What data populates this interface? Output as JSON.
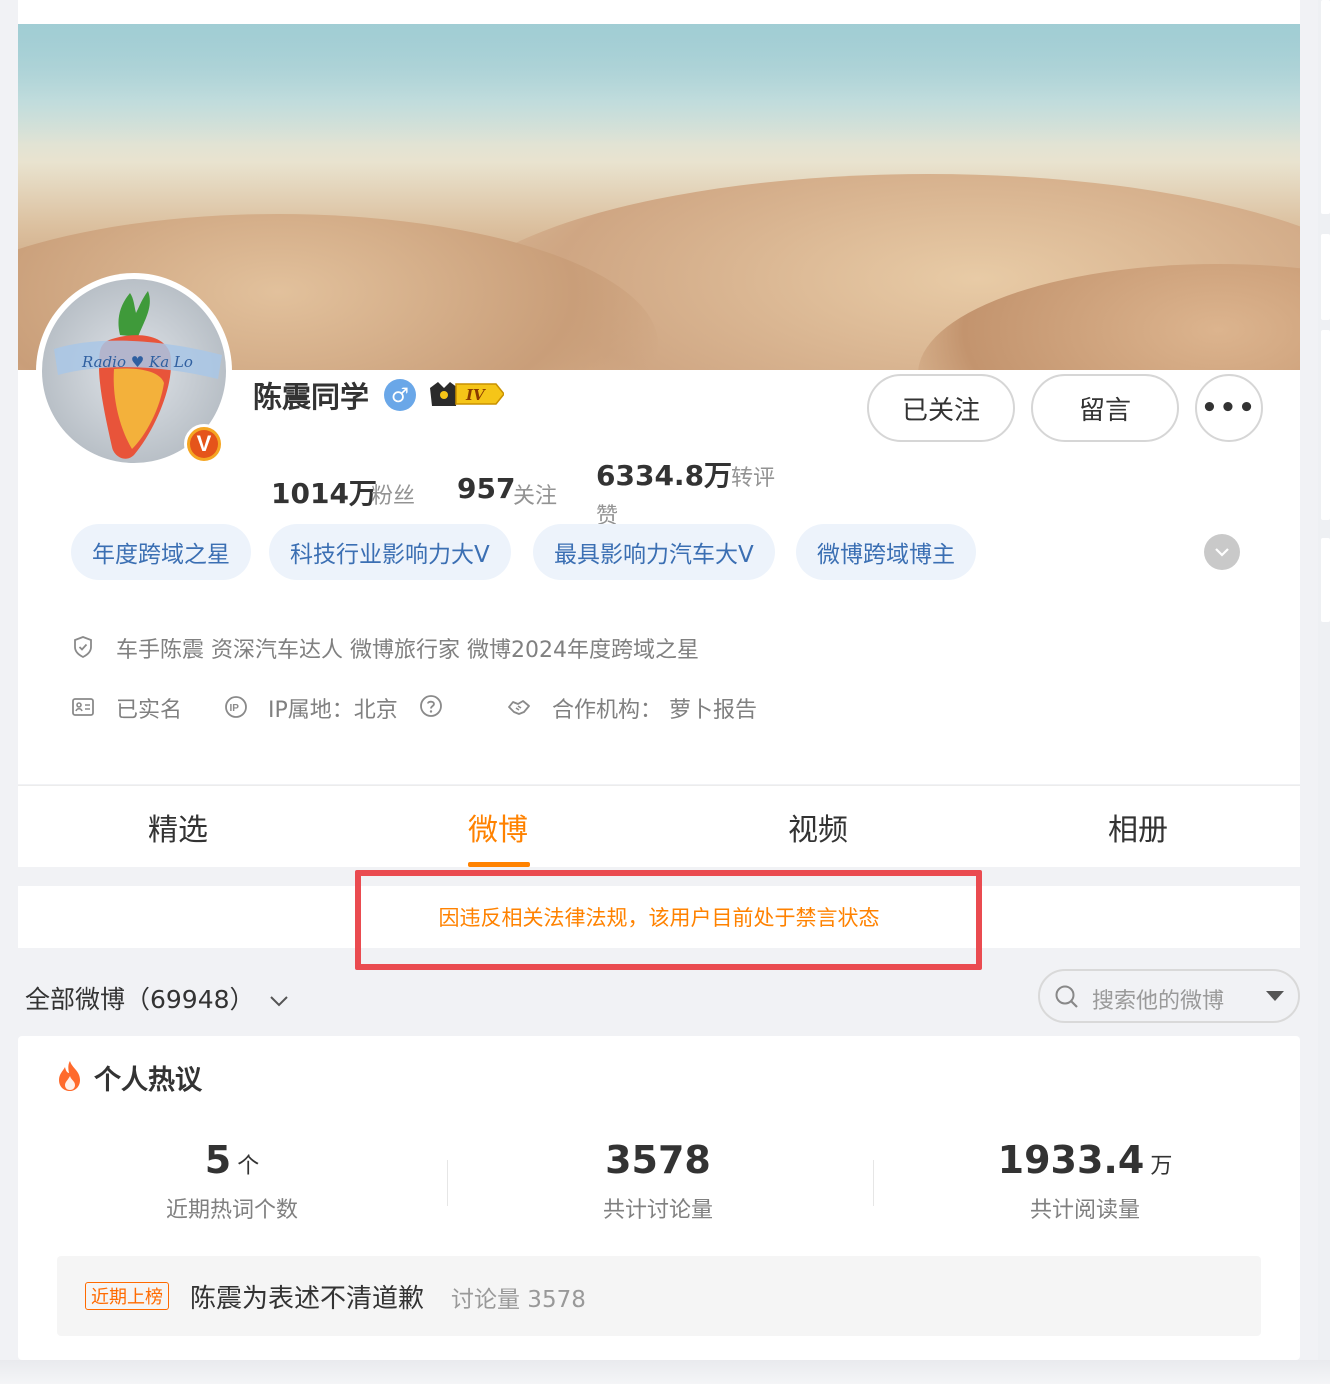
{
  "profile": {
    "name": "陈震同学",
    "gender_symbol": "♂",
    "level": "IV",
    "verified_mark": "V",
    "stats": [
      {
        "value": "1014万",
        "label": "粉丝"
      },
      {
        "value": "957",
        "label": "关注"
      },
      {
        "value": "6334.8万",
        "label": "转评",
        "label2": "赞"
      }
    ],
    "buttons": {
      "followed": "已关注",
      "message": "留言",
      "more": "•••"
    },
    "tags": [
      "年度跨域之星",
      "科技行业影响力大V",
      "最具影响力汽车大V",
      "微博跨域博主"
    ],
    "bio": "车手陈震 资深汽车达人 微博旅行家 微博2024年度跨域之星",
    "real_name": "已实名",
    "ip": "IP属地：北京",
    "agency": "合作机构： 萝卜报告"
  },
  "tabs": [
    {
      "label": "精选",
      "active": false
    },
    {
      "label": "微博",
      "active": true
    },
    {
      "label": "视频",
      "active": false
    },
    {
      "label": "相册",
      "active": false
    }
  ],
  "notice": "因违反相关法律法规，该用户目前处于禁言状态",
  "feed": {
    "all_label": "全部微博（69948）",
    "search_placeholder": "搜索他的微博"
  },
  "hot": {
    "title": "个人热议",
    "metrics": [
      {
        "value": "5",
        "unit": "个",
        "label": "近期热词个数"
      },
      {
        "value": "3578",
        "unit": "",
        "label": "共计讨论量"
      },
      {
        "value": "1933.4",
        "unit": "万",
        "label": "共计阅读量"
      }
    ],
    "trend": {
      "badge": "近期上榜",
      "text": "陈震为表述不清道歉",
      "count": "讨论量 3578"
    }
  },
  "colors": {
    "accent": "#ff8200",
    "tag_bg": "#edf3fb",
    "tag_text": "#3b6fb3",
    "highlight_border": "#ea4b50"
  },
  "icons": [
    "shield-icon",
    "id-card-icon",
    "ip-icon",
    "question-icon",
    "handshake-icon",
    "search-icon",
    "fire-icon",
    "chevron-down-icon",
    "crown-icon"
  ]
}
